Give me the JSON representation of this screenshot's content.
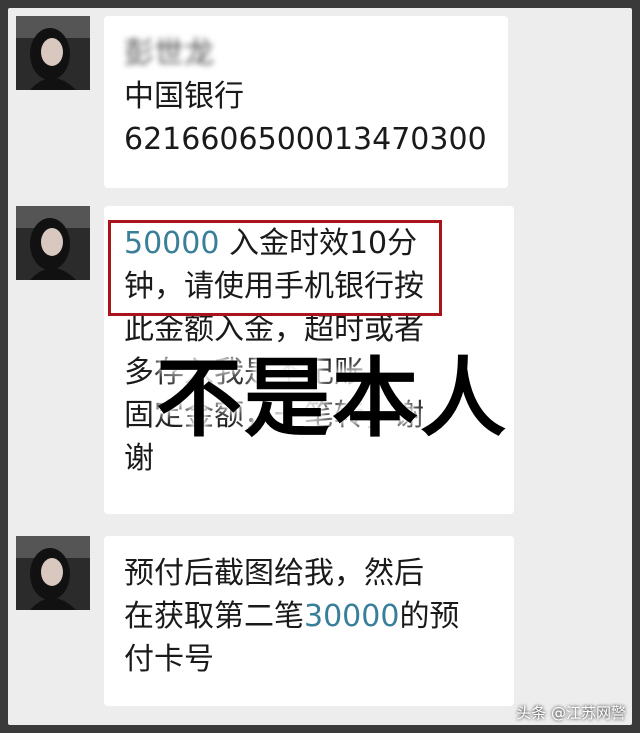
{
  "messages": [
    {
      "lines": [
        "彭世龙",
        "中国银行",
        "6216606500013470300"
      ]
    },
    {
      "lines_1_amount": "50000",
      "lines_1_rest": " 入金时效10分",
      "lines": [
        "钟，请使用手机银行按",
        "此金额入金，超时或者",
        "多存入我是不记账。",
        "固定金额，一笔转，谢",
        "谢"
      ]
    },
    {
      "line_1": "预付后截图给我，然后",
      "line_2_pre": "在获取第二笔",
      "line_2_amount": "30000",
      "line_2_post": "的预",
      "line_3": "付卡号"
    }
  ],
  "overlay": "不是本人",
  "watermark": "头条 @江苏网警",
  "colors": {
    "amount_blue": "#3a7f9a",
    "highlight_red": "#a8141a"
  }
}
